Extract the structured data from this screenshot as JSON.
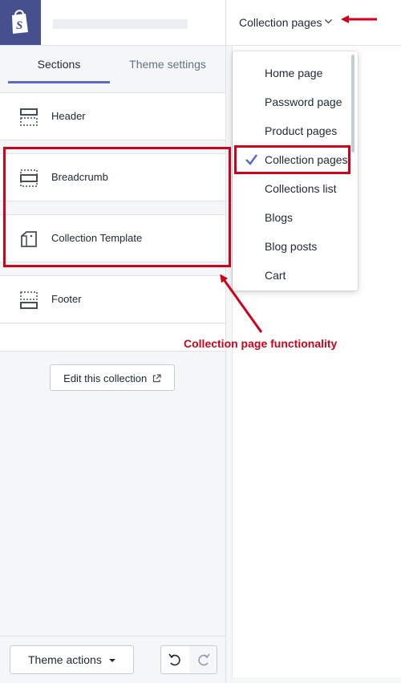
{
  "store": {
    "logo_icon": "shopify-bag-icon",
    "brand_color": "#47508f"
  },
  "tabs": [
    {
      "label": "Sections"
    },
    {
      "label": "Theme settings"
    }
  ],
  "sections": [
    {
      "label": "Header",
      "icon": "header-layout-icon"
    },
    {
      "label": "Breadcrumb",
      "icon": "breadcrumb-layout-icon"
    },
    {
      "label": "Collection Template",
      "icon": "collection-template-icon"
    },
    {
      "label": "Footer",
      "icon": "footer-layout-icon"
    }
  ],
  "edit_button": {
    "label": "Edit this collection",
    "icon": "external-link-icon"
  },
  "bottom": {
    "theme_actions_label": "Theme actions",
    "undo_icon": "undo-icon",
    "redo_icon": "redo-icon"
  },
  "page_selector": {
    "current": "Collection pages",
    "icon": "chevron-down-icon"
  },
  "dropdown": {
    "items": [
      {
        "label": "Home page"
      },
      {
        "label": "Password page"
      },
      {
        "label": "Product pages"
      },
      {
        "label": "Collection pages",
        "selected": true
      },
      {
        "label": "Collections list"
      },
      {
        "label": "Blogs"
      },
      {
        "label": "Blog posts"
      },
      {
        "label": "Cart"
      }
    ]
  },
  "annotation": {
    "text": "Collection page functionality",
    "color": "#d0021b"
  },
  "colors": {
    "accent": "#5c6ac4",
    "annotation_red": "#d0021b"
  }
}
